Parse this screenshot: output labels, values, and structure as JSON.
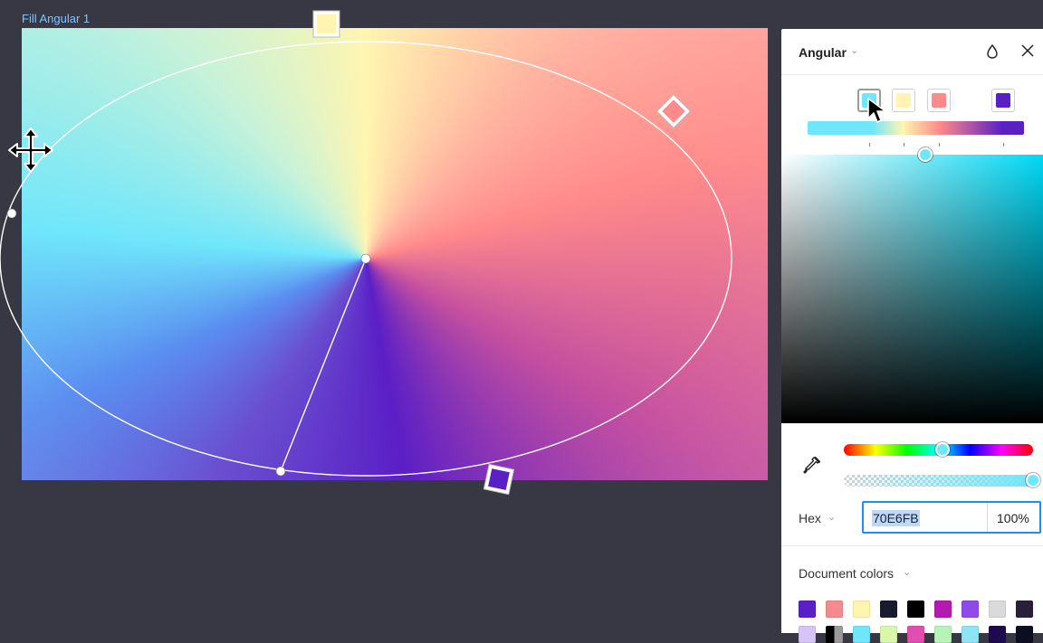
{
  "canvas": {
    "frame_label": "Fill Angular 1",
    "stop_colors": [
      "#70E6FB",
      "#FFF5B0",
      "#FF8A8A",
      "#5B1FC6"
    ]
  },
  "panel": {
    "fill_type": "Angular",
    "fill_type_chevron": "⌄",
    "gradient_stops": [
      {
        "color": "#70E6FB",
        "position": 0.3,
        "selected": true
      },
      {
        "color": "#FFF5B0",
        "position": 0.44,
        "selected": false
      },
      {
        "color": "#FF8A8A",
        "position": 0.61,
        "selected": false
      },
      {
        "color": "#5B1FC6",
        "position": 0.9,
        "selected": false
      }
    ],
    "picker": {
      "hue_fraction": 0.52,
      "alpha_fraction": 1.0,
      "saturation_fraction": 0.55,
      "brightness_fraction": 1.0
    },
    "color_mode": "Hex",
    "color_mode_chevron": "⌄",
    "hex_value": "70E6FB",
    "alpha_value": "100%",
    "document_colors_label": "Document colors",
    "document_colors_chevron": "⌄",
    "document_colors_row1": [
      "#5B1FC6",
      "#F28B8F",
      "#FFF5B0",
      "#1B1B2F",
      "#000000",
      "#B31BB0",
      "#8F4AE8",
      "#DADADA",
      "#2A1F38"
    ],
    "document_colors_row2": [
      "#D5C4F5",
      "#9A9A9A",
      "#70E6FB",
      "#D8F7A8",
      "#E04FB0",
      "#B7F2B7",
      "#8EE3F5",
      "#1E0A4E",
      "#0E0E22"
    ]
  },
  "colors": {
    "accent": "#1A8EF5",
    "canvas_bg": "#383845",
    "frame_label": "#7CC4FF"
  }
}
